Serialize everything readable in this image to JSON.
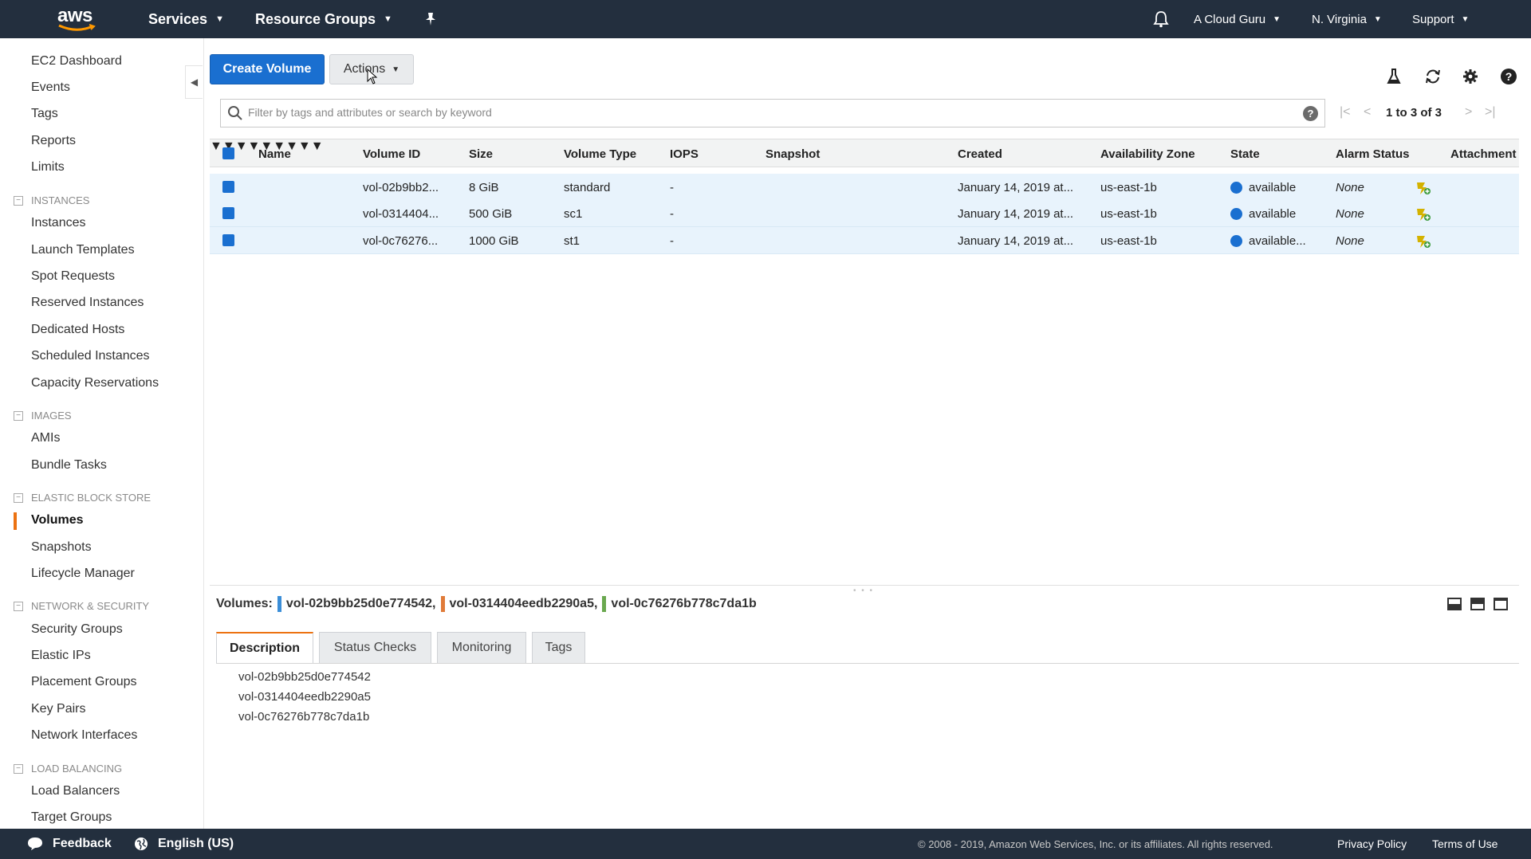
{
  "nav": {
    "logo_text": "aws",
    "services": "Services",
    "resource_groups": "Resource Groups",
    "account": "A Cloud Guru",
    "region": "N. Virginia",
    "support": "Support"
  },
  "sidebar": {
    "top_items": [
      "EC2 Dashboard",
      "Events",
      "Tags",
      "Reports",
      "Limits"
    ],
    "sections": [
      {
        "title": "INSTANCES",
        "items": [
          "Instances",
          "Launch Templates",
          "Spot Requests",
          "Reserved Instances",
          "Dedicated Hosts",
          "Scheduled Instances",
          "Capacity Reservations"
        ]
      },
      {
        "title": "IMAGES",
        "items": [
          "AMIs",
          "Bundle Tasks"
        ]
      },
      {
        "title": "ELASTIC BLOCK STORE",
        "items": [
          "Volumes",
          "Snapshots",
          "Lifecycle Manager"
        ]
      },
      {
        "title": "NETWORK & SECURITY",
        "items": [
          "Security Groups",
          "Elastic IPs",
          "Placement Groups",
          "Key Pairs",
          "Network Interfaces"
        ]
      },
      {
        "title": "LOAD BALANCING",
        "items": [
          "Load Balancers",
          "Target Groups"
        ]
      }
    ],
    "active_item": "Volumes"
  },
  "toolbar": {
    "create_label": "Create Volume",
    "actions_label": "Actions"
  },
  "search": {
    "placeholder": "Filter by tags and attributes or search by keyword",
    "value": ""
  },
  "pager": {
    "range_text": "1 to 3 of 3"
  },
  "table": {
    "columns": [
      "Name",
      "Volume ID",
      "Size",
      "Volume Type",
      "IOPS",
      "Snapshot",
      "Created",
      "Availability Zone",
      "State",
      "Alarm Status",
      "Attachment"
    ],
    "rows": [
      {
        "name": "",
        "volume_id": "vol-02b9bb2...",
        "size": "8 GiB",
        "type": "standard",
        "iops": "-",
        "snapshot": "",
        "created": "January 14, 2019 at...",
        "az": "us-east-1b",
        "state": "available",
        "alarm": "None"
      },
      {
        "name": "",
        "volume_id": "vol-0314404...",
        "size": "500 GiB",
        "type": "sc1",
        "iops": "-",
        "snapshot": "",
        "created": "January 14, 2019 at...",
        "az": "us-east-1b",
        "state": "available",
        "alarm": "None"
      },
      {
        "name": "",
        "volume_id": "vol-0c76276...",
        "size": "1000 GiB",
        "type": "st1",
        "iops": "-",
        "snapshot": "",
        "created": "January 14, 2019 at...",
        "az": "us-east-1b",
        "state": "available...",
        "alarm": "None"
      }
    ]
  },
  "details": {
    "label": "Volumes:",
    "volumes": [
      {
        "id": "vol-02b9bb25d0e774542,",
        "color": "#3b8ed8"
      },
      {
        "id": "vol-0314404eedb2290a5,",
        "color": "#e07b39"
      },
      {
        "id": "vol-0c76276b778c7da1b",
        "color": "#6aa84f"
      }
    ],
    "tabs": [
      "Description",
      "Status Checks",
      "Monitoring",
      "Tags"
    ],
    "active_tab": "Description",
    "description_lines": [
      "vol-02b9bb25d0e774542",
      "vol-0314404eedb2290a5",
      "vol-0c76276b778c7da1b"
    ]
  },
  "footer": {
    "feedback": "Feedback",
    "language": "English (US)",
    "copyright": "© 2008 - 2019, Amazon Web Services, Inc. or its affiliates. All rights reserved.",
    "privacy": "Privacy Policy",
    "terms": "Terms of Use"
  },
  "colors": {
    "nav_bg": "#232f3e",
    "primary": "#1a6fd0",
    "accent": "#ec7211",
    "row_selected": "#e8f3fc"
  }
}
